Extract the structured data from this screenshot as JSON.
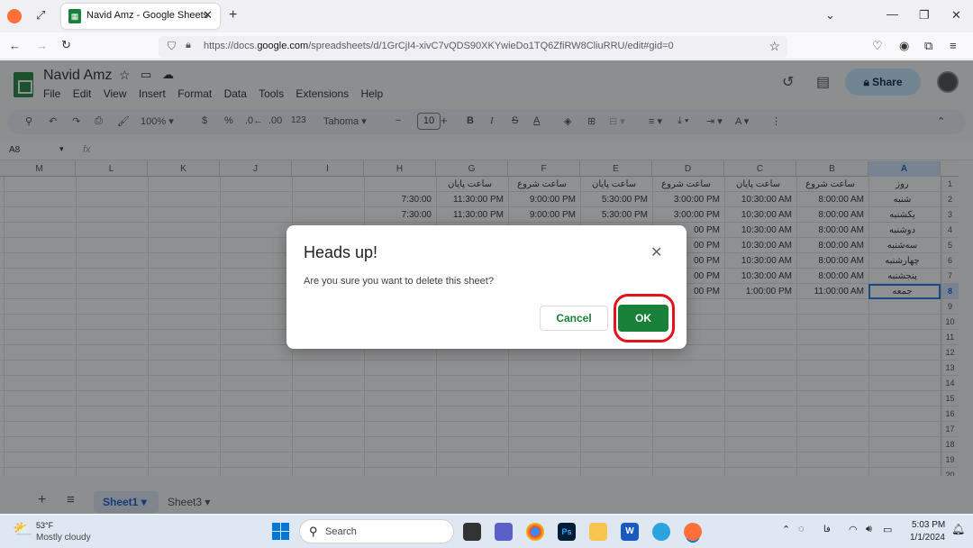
{
  "browser": {
    "tab_title": "Navid Amz - Google Sheets",
    "url_prefix": "https://docs.",
    "url_domain": "google.com",
    "url_suffix": "/spreadsheets/d/1GrCjI4-xivC7vQDS90XKYwieDo1TQ6ZfiRW8CliuRRU/edit#gid=0"
  },
  "doc": {
    "title": "Navid Amz",
    "menus": [
      "File",
      "Edit",
      "View",
      "Insert",
      "Format",
      "Data",
      "Tools",
      "Extensions",
      "Help"
    ],
    "share_label": "Share"
  },
  "toolbar": {
    "zoom": "100%",
    "currency": "$",
    "percent": "%",
    "dec_dec": ".0←",
    "dec_inc": ".00",
    "format_123": "123",
    "font": "Tahoma",
    "font_size": "10"
  },
  "formula_bar": {
    "name_box": "A8",
    "fx": "fx"
  },
  "grid": {
    "columns": [
      "M",
      "L",
      "K",
      "J",
      "I",
      "H",
      "G",
      "F",
      "E",
      "D",
      "C",
      "B",
      "A"
    ],
    "rows": [
      "1",
      "2",
      "3",
      "4",
      "5",
      "6",
      "7",
      "8",
      "9",
      "10",
      "11",
      "12",
      "13",
      "14",
      "15",
      "16",
      "17",
      "18",
      "19",
      "20"
    ],
    "col_A": [
      "روز",
      "شنبه",
      "یکشنبه",
      "دوشنبه",
      "سه‌شنبه",
      "چهارشنبه",
      "پنجشنبه",
      "جمعه"
    ],
    "col_B": [
      "ساعت شروع",
      "8:00:00 AM",
      "8:00:00 AM",
      "8:00:00 AM",
      "8:00:00 AM",
      "8:00:00 AM",
      "8:00:00 AM",
      "11:00:00 AM"
    ],
    "col_C": [
      "ساعت پایان",
      "10:30:00 AM",
      "10:30:00 AM",
      "10:30:00 AM",
      "10:30:00 AM",
      "10:30:00 AM",
      "10:30:00 AM",
      "1:00:00 PM"
    ],
    "col_D": [
      "ساعت شروع",
      "3:00:00 PM",
      "3:00:00 PM",
      "00 PM",
      "00 PM",
      "00 PM",
      "00 PM",
      "00 PM"
    ],
    "col_E": [
      "ساعت پایان",
      "5:30:00 PM",
      "5:30:00 PM"
    ],
    "col_F": [
      "ساعت شروع",
      "9:00:00 PM",
      "9:00:00 PM"
    ],
    "col_G": [
      "ساعت پایان",
      "11:30:00 PM",
      "11:30:00 PM"
    ],
    "col_H": [
      "",
      "7:30:00",
      "7:30:00"
    ]
  },
  "dialog": {
    "title": "Heads up!",
    "message": "Are you sure you want to delete this sheet?",
    "cancel_label": "Cancel",
    "ok_label": "OK"
  },
  "sheets": {
    "tab1": "Sheet1",
    "tab2": "Sheet3"
  },
  "taskbar": {
    "temp": "53°F",
    "weather": "Mostly cloudy",
    "search_label": "Search",
    "lang": "فا",
    "time": "5:03 PM",
    "date": "1/1/2024"
  }
}
